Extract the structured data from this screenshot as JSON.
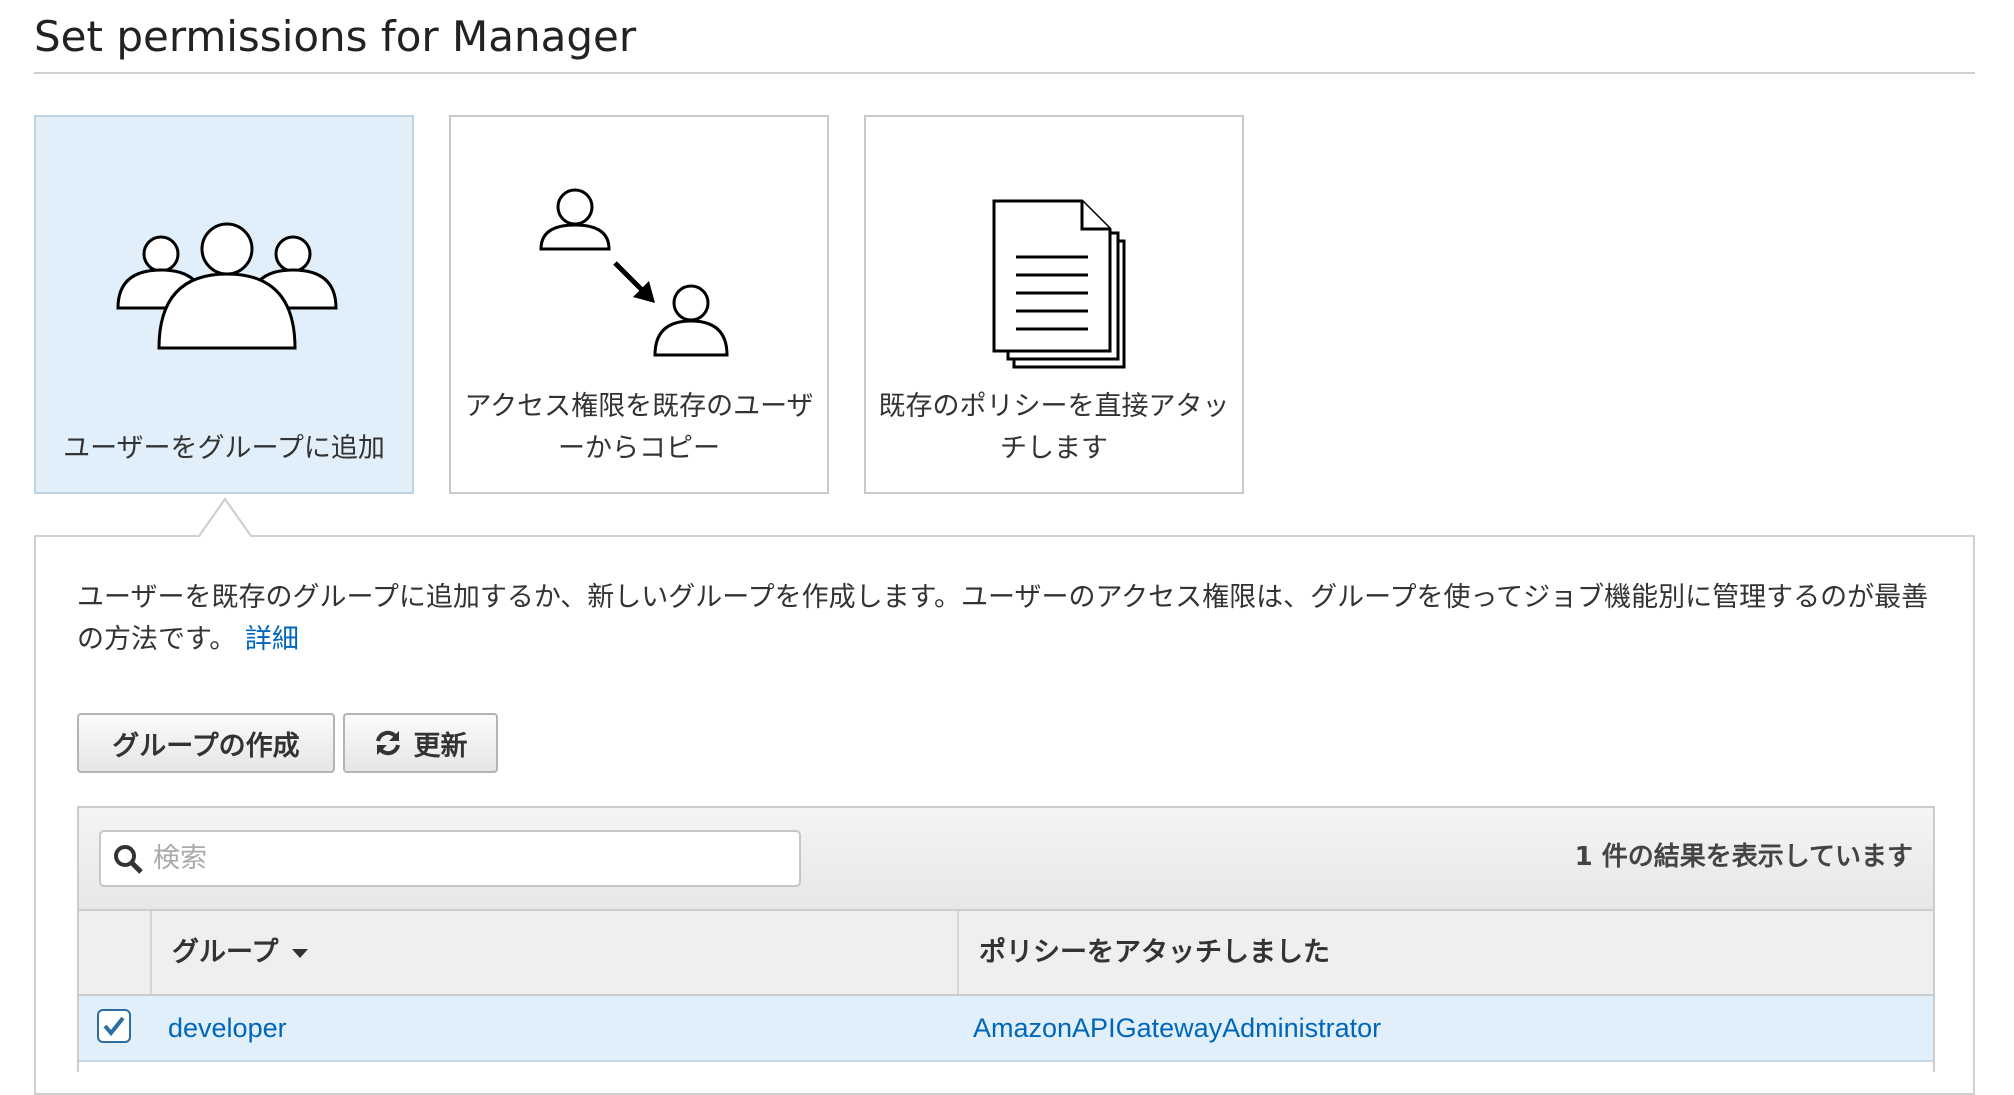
{
  "page": {
    "title": "Set permissions for Manager"
  },
  "options": [
    {
      "label": "ユーザーをグループに追加",
      "icon": "group-users-icon",
      "selected": true
    },
    {
      "label": "アクセス権限を既存のユーザーからコピー",
      "icon": "copy-user-icon",
      "selected": false
    },
    {
      "label": "既存のポリシーを直接アタッチします",
      "icon": "policy-document-icon",
      "selected": false
    }
  ],
  "panel": {
    "description": "ユーザーを既存のグループに追加するか、新しいグループを作成します。ユーザーのアクセス権限は、グループを使ってジョブ機能別に管理するのが最善の方法です。",
    "details_link": "詳細"
  },
  "toolbar": {
    "create_group_label": "グループの作成",
    "refresh_label": "更新",
    "refresh_icon": "refresh-icon"
  },
  "search": {
    "placeholder": "検索",
    "value": "",
    "icon": "search-icon"
  },
  "results": {
    "count_text": "1 件の結果を表示しています"
  },
  "table": {
    "columns": [
      {
        "label": "グループ",
        "sortable": true
      },
      {
        "label": "ポリシーをアタッチしました"
      }
    ],
    "rows": [
      {
        "group": "developer",
        "policy": "AmazonAPIGatewayAdministrator",
        "checked": true
      }
    ]
  },
  "colors": {
    "selected_bg": "#e1effa",
    "link": "#0066bb",
    "checkbox": "#2e6da4"
  }
}
